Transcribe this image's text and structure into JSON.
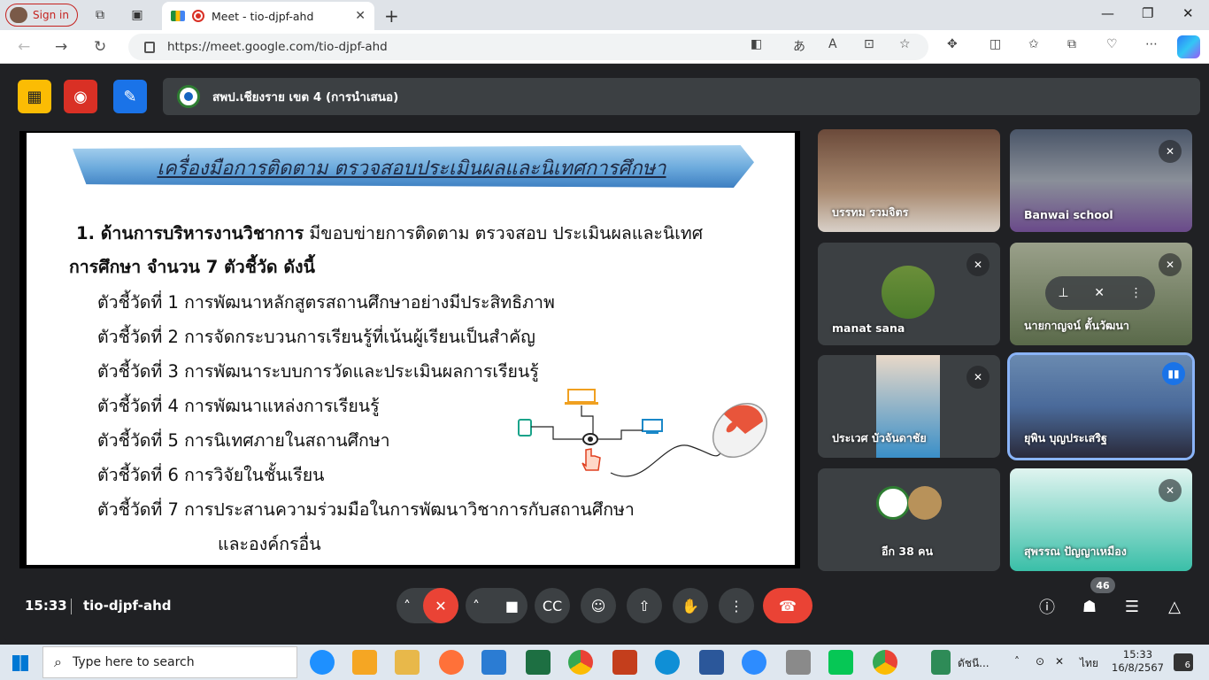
{
  "browser": {
    "signin_label": "Sign in",
    "tab_title": "Meet - tio-djpf-ahd",
    "url": "https://meet.google.com/tio-djpf-ahd"
  },
  "meet": {
    "presenter_label": "สพป.เชียงราย เขต 4 (การนำเสนอ)",
    "slide": {
      "title": "เครื่องมือการติดตาม ตรวจสอบประเมินผลและนิเทศการศึกษา",
      "heading_bold": "1. ด้านการบริหารงานวิชาการ",
      "heading_rest": " มีขอบข่ายการติดตาม ตรวจสอบ ประเมินผลและนิเทศ",
      "heading_line2": "การศึกษา จำนวน 7 ตัวชี้วัด ดังนี้",
      "indicators": [
        "ตัวชี้วัดที่ 1 การพัฒนาหลักสูตรสถานศึกษาอย่างมีประสิทธิภาพ",
        "ตัวชี้วัดที่ 2 การจัดกระบวนการเรียนรู้ที่เน้นผู้เรียนเป็นสำคัญ",
        "ตัวชี้วัดที่ 3 การพัฒนาระบบการวัดและประเมินผลการเรียนรู้",
        "ตัวชี้วัดที่ 4 การพัฒนาแหล่งการเรียนรู้",
        "ตัวชี้วัดที่ 5 การนิเทศภายในสถานศึกษา",
        "ตัวชี้วัดที่ 6 การวิจัยในชั้นเรียน",
        "ตัวชี้วัดที่ 7 การประสานความร่วมมือในการพัฒนาวิชาการกับสถานศึกษา"
      ],
      "indicator_7_cont": "และองค์กรอื่น"
    },
    "participants": [
      {
        "name": "บรรทม รวมจิตร"
      },
      {
        "name": "Banwai school"
      },
      {
        "name": "manat sana"
      },
      {
        "name": "นายกาญจน์ ตั้นวัฒนา"
      },
      {
        "name": "ประเวศ บัวจันดาชัย"
      },
      {
        "name": "ยุพิน บุญประเสริฐ"
      },
      {
        "name": "อีก 38 คน"
      },
      {
        "name": "สุพรรณ ปัญญาเหมือง"
      }
    ],
    "clock": "15:33",
    "meeting_code": "tio-djpf-ahd",
    "people_count": "46"
  },
  "taskbar": {
    "search_placeholder": "Type here to search",
    "app_label": "ดัชนี...",
    "lang": "ไทย",
    "time": "15:33",
    "date": "16/8/2567",
    "notif_count": "6"
  }
}
